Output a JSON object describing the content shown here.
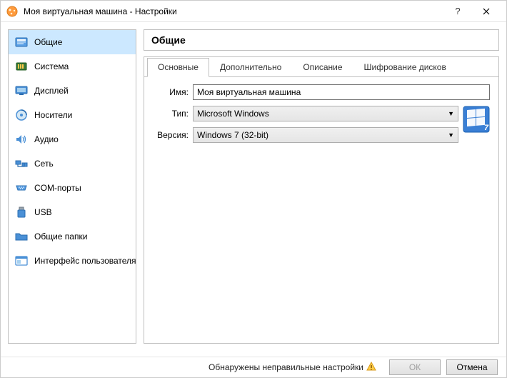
{
  "window": {
    "title": "Моя виртуальная машина - Настройки"
  },
  "sidebar": {
    "items": [
      {
        "label": "Общие"
      },
      {
        "label": "Система"
      },
      {
        "label": "Дисплей"
      },
      {
        "label": "Носители"
      },
      {
        "label": "Аудио"
      },
      {
        "label": "Сеть"
      },
      {
        "label": "COM-порты"
      },
      {
        "label": "USB"
      },
      {
        "label": "Общие папки"
      },
      {
        "label": "Интерфейс пользователя"
      }
    ]
  },
  "section": {
    "title": "Общие"
  },
  "tabs": [
    {
      "label": "Основные"
    },
    {
      "label": "Дополнительно"
    },
    {
      "label": "Описание"
    },
    {
      "label": "Шифрование дисков"
    }
  ],
  "form": {
    "name_label": "Имя:",
    "name_value": "Моя виртуальная машина",
    "type_label": "Тип:",
    "type_value": "Microsoft Windows",
    "version_label": "Версия:",
    "version_value": "Windows 7 (32-bit)"
  },
  "footer": {
    "warning": "Обнаружены неправильные настройки",
    "ok": "ОК",
    "cancel": "Отмена"
  }
}
